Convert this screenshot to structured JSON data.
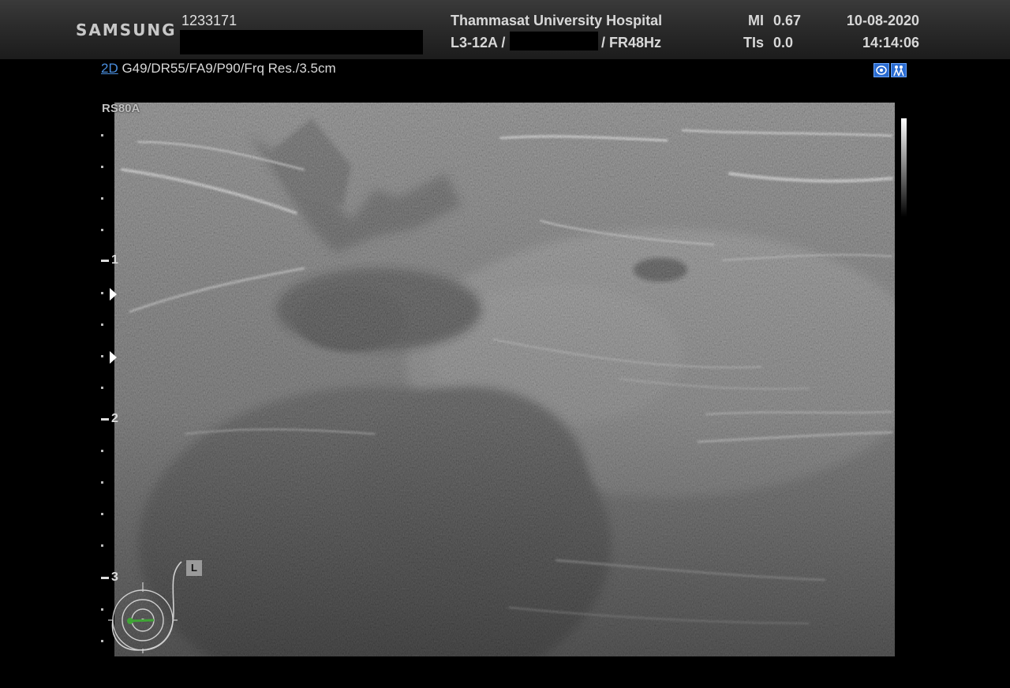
{
  "header": {
    "brand": "SAMSUNG",
    "patient_id": "1233171",
    "hospital": "Thammasat University Hospital",
    "probe": "L3-12A /",
    "frame_rate": "/ FR48Hz",
    "mi_label": "MI",
    "mi_value": "0.67",
    "tis_label": "TIs",
    "tis_value": "0.0",
    "date": "10-08-2020",
    "time": "14:14:06"
  },
  "mode": {
    "mode_label": "2D",
    "params": " G49/DR55/FA9/P90/Frq Res./3.5cm"
  },
  "image": {
    "preset": "RS80A",
    "side_marker": "L"
  },
  "depth_scale": {
    "labels": [
      "1",
      "2",
      "3"
    ],
    "unit": "cm"
  },
  "icons": {
    "top_left_icon": "probe-icon",
    "top_right_icon": "people-icon",
    "body_marker": "breast-body-marker-icon"
  },
  "colors": {
    "mode_accent": "#4a8fe0",
    "probe_marker": "#3fa535"
  }
}
